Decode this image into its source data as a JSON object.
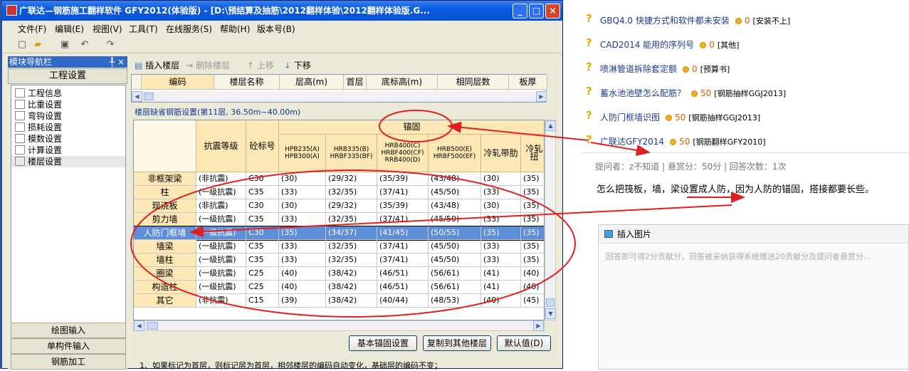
{
  "window": {
    "title": "广联达—钢筋施工翻样软件 GFY2012(体验版) - [D:\\预结算及抽筋\\2012翻样体验\\2012翻样体验版.G...",
    "controls": [
      "_",
      "□",
      "×"
    ]
  },
  "menu": [
    "文件(F)",
    "编辑(E)",
    "视图(V)",
    "工具(T)",
    "在线服务(S)",
    "帮助(H)",
    "版本号(B)"
  ],
  "nav": {
    "title": "模块导航栏",
    "pin": "╀",
    "close": "×",
    "section": "工程设置",
    "items": [
      {
        "label": "工程信息",
        "icon": "info-icon"
      },
      {
        "label": "比重设置",
        "icon": "weight-icon"
      },
      {
        "label": "弯钩设置",
        "icon": "hook-icon"
      },
      {
        "label": "损耗设置",
        "icon": "loss-icon"
      },
      {
        "label": "模数设置",
        "icon": "modulus-icon"
      },
      {
        "label": "计算设置",
        "icon": "calc-icon"
      },
      {
        "label": "楼层设置",
        "icon": "floor-icon"
      }
    ],
    "bottom": [
      "绘图输入",
      "单构件输入",
      "钢筋加工"
    ]
  },
  "floor_toolbar": {
    "insert": "插入楼层",
    "delete": "删除楼层",
    "up": "上移",
    "down": "下移"
  },
  "floor_grid": {
    "headers": [
      "编码",
      "楼层名称",
      "层高(m)",
      "首层",
      "底标高(m)",
      "相同层数",
      "板厚(mm)"
    ]
  },
  "section_title": "楼层缺省钢筋设置(第11层, 36.50m~40.00m)",
  "anchor_grid": {
    "group_header": "锚固",
    "headers": {
      "seismic": "抗震等级",
      "concrete": "砼标号",
      "hpb": "HPB235(A) HPB300(A)",
      "hrb335": "HRB335(B) HRBF335(BF)",
      "hrb400": "HRB400(C) HRBF400(CF) RRB400(D)",
      "hrb500": "HRB500(E) HRBF500(EF)",
      "cold": "冷轧带肋",
      "cold2": "冷轧扭"
    },
    "rows": [
      [
        "非框架梁",
        "(非抗震)",
        "C30",
        "(30)",
        "(29/32)",
        "(35/39)",
        "(43/48)",
        "(30)",
        "(35)"
      ],
      [
        "柱",
        "(一级抗震)",
        "C35",
        "(33)",
        "(32/35)",
        "(37/41)",
        "(45/50)",
        "(33)",
        "(35)"
      ],
      [
        "现浇板",
        "(非抗震)",
        "C30",
        "(30)",
        "(29/32)",
        "(35/39)",
        "(43/48)",
        "(30)",
        "(35)"
      ],
      [
        "剪力墙",
        "(一级抗震)",
        "C35",
        "(33)",
        "(32/35)",
        "(37/41)",
        "(45/50)",
        "(33)",
        "(35)"
      ],
      [
        "人防门框墙",
        "(一级抗震)",
        "C30",
        "(35)",
        "(34/37)",
        "(41/45)",
        "(50/55)",
        "(35)",
        "(35)"
      ],
      [
        "墙梁",
        "(一级抗震)",
        "C35",
        "(33)",
        "(32/35)",
        "(37/41)",
        "(45/50)",
        "(33)",
        "(35)"
      ],
      [
        "墙柱",
        "(一级抗震)",
        "C35",
        "(33)",
        "(32/35)",
        "(37/41)",
        "(45/50)",
        "(33)",
        "(35)"
      ],
      [
        "圈梁",
        "(一级抗震)",
        "C25",
        "(40)",
        "(38/42)",
        "(46/51)",
        "(56/61)",
        "(41)",
        "(40)"
      ],
      [
        "构造柱",
        "(一级抗震)",
        "C25",
        "(40)",
        "(38/42)",
        "(46/51)",
        "(56/61)",
        "(41)",
        "(40)"
      ],
      [
        "其它",
        "(非抗震)",
        "C15",
        "(39)",
        "(38/42)",
        "(40/44)",
        "(48/53)",
        "(40)",
        "(45)"
      ]
    ],
    "selected_row": 4
  },
  "buttons": {
    "basic": "基本锚固设置",
    "copy": "复制到其他楼层",
    "default": "默认值(D)"
  },
  "note": "1、如果标记为首层，则标记层为首层，相邻楼层的编码自动变化，基础层的编码不变；",
  "questions": [
    {
      "title": "GBQ4.0 快捷方式和软件都未安装",
      "coins": "0",
      "tag": "[安装不上]"
    },
    {
      "title": "CAD2014 能用的序列号",
      "coins": "0",
      "tag": "[其他]"
    },
    {
      "title": "喷淋管道拆除套定额",
      "coins": "0",
      "tag": "[预算书]"
    },
    {
      "title": "蓄水池池壁怎么配筋？",
      "coins": "50",
      "tag": "[钢筋抽样GGJ2013]"
    },
    {
      "title": "人防门框墙识图",
      "coins": "50",
      "tag": "[钢筋抽样GGJ2013]"
    },
    {
      "title": "广联达GFY2014",
      "coins": "50",
      "tag": "[钢筋翻样GFY2010]"
    }
  ],
  "question_detail": {
    "meta": "提问者：z不知道  |  悬赏分：50分  |  回答次数：1次",
    "text": "怎么把筏板，墙，梁设置成人防，因为人防的锚固，搭接都要长些。",
    "insert_image": "插入图片",
    "placeholder": "回答即可得2分贡献分，回答被采纳获得系统赠送20贡献分及提问者悬赏分..."
  },
  "colors": {
    "selection": "#5f8ed9",
    "header": "#fde7b4",
    "annotation": "#e02020",
    "link": "#1c3c8c"
  }
}
